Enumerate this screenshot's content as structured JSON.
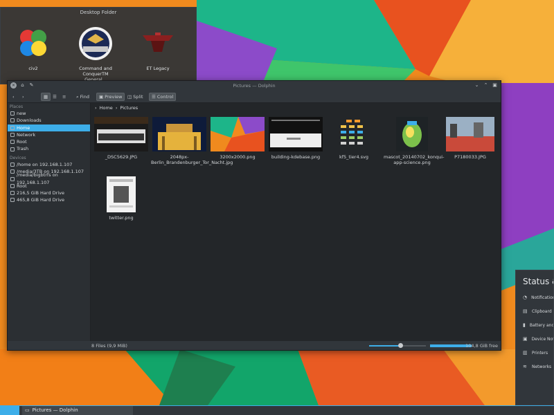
{
  "desktop_folder": {
    "title": "Desktop Folder",
    "icons": [
      {
        "label": "civ2",
        "icon": "clover-icon"
      },
      {
        "label": "Command and ConquerTM General...",
        "icon": "cnc-badge-icon"
      },
      {
        "label": "ET Legacy",
        "icon": "et-legacy-icon"
      }
    ]
  },
  "window": {
    "title": "Pictures — Dolphin",
    "toolbar": {
      "find": "Find",
      "preview": "Preview",
      "split": "Split",
      "control": "Control"
    },
    "sidebar": {
      "places_header": "Places",
      "places": [
        "new",
        "Downloads",
        "Home",
        "Network",
        "Root",
        "Trash"
      ],
      "selected": "Home",
      "devices_header": "Devices",
      "devices": [
        "/home on 192.168.1.107",
        "/media/3TB on 192.168.1.107",
        "/media/bigbtrfs on 192.168.1.107",
        "Root",
        "216,5 GiB Hard Drive",
        "465,8 GiB Hard Drive"
      ]
    },
    "breadcrumb": {
      "home": "Home",
      "sep": "›",
      "current": "Pictures"
    },
    "files": [
      {
        "name": "_DSC5629.JPG"
      },
      {
        "name": "2048px-Berlin_Brandenburger_Tor_Nacht.jpg"
      },
      {
        "name": "3200x2000.png"
      },
      {
        "name": "building-kdebase.png"
      },
      {
        "name": "kf5_tier4.svg"
      },
      {
        "name": "mascot_20140702_konqui-app-science.png"
      },
      {
        "name": "P7180033.JPG"
      },
      {
        "name": "twitter.png"
      }
    ],
    "status": {
      "summary": "8 Files (9,9 MiB)",
      "free": "104,8 GiB free",
      "zoom_fraction": 0.55
    }
  },
  "status_panel": {
    "title": "Status & Notifications",
    "rows": [
      {
        "label": "Notifications",
        "icon": "bell-icon"
      },
      {
        "label": "Clipboard",
        "icon": "clipboard-icon"
      },
      {
        "label": "Battery and Brightness",
        "icon": "battery-icon"
      },
      {
        "label": "Device Notifier",
        "icon": "device-icon"
      },
      {
        "label": "Printers",
        "icon": "printer-icon"
      },
      {
        "label": "Networks",
        "icon": "network-icon"
      }
    ]
  },
  "taskbar": {
    "task_label": "Pictures — Dolphin"
  }
}
